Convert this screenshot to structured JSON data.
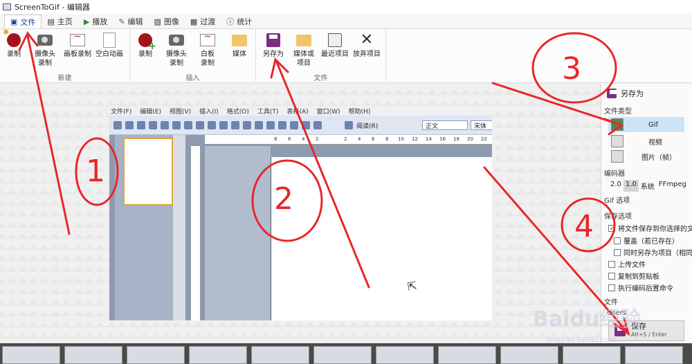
{
  "window": {
    "title": "ScreenToGif - 编辑器"
  },
  "tabs": [
    {
      "label": "文件",
      "icon": "save-icon",
      "active": true
    },
    {
      "label": "主页",
      "icon": "home-icon"
    },
    {
      "label": "播放",
      "icon": "play-icon"
    },
    {
      "label": "编辑",
      "icon": "pencil-icon"
    },
    {
      "label": "图像",
      "icon": "image-icon"
    },
    {
      "label": "过渡",
      "icon": "transition-icon"
    },
    {
      "label": "统计",
      "icon": "info-icon"
    }
  ],
  "ribbon": {
    "groups": [
      {
        "name": "新建",
        "items": [
          "录制",
          "摄像头\n录制",
          "画板录制",
          "空白动画"
        ]
      },
      {
        "name": "插入",
        "items": [
          "录制",
          "摄像头\n录制",
          "白板\n录制",
          "媒体"
        ]
      },
      {
        "name": "文件",
        "items": [
          "另存为",
          "媒体或\n项目",
          "最近项目",
          "放弃项目"
        ]
      }
    ]
  },
  "embedded_word": {
    "menu": [
      "文件(F)",
      "编辑(E)",
      "视图(V)",
      "插入(I)",
      "格式(O)",
      "工具(T)",
      "表格(A)",
      "窗口(W)",
      "帮助(H)"
    ],
    "read_button": "阅读(R)",
    "style_combo": "正文",
    "font_combo": "宋体",
    "ruler_numbers": [
      "8",
      "6",
      "4",
      "2",
      "2",
      "4",
      "6",
      "8",
      "10",
      "12",
      "14",
      "16",
      "18",
      "20",
      "22"
    ]
  },
  "save_panel": {
    "title": "另存为",
    "file_type_label": "文件类型",
    "types": [
      "Gif",
      "视频",
      "图片（帧）"
    ],
    "selected_type": "Gif",
    "encoder_label": "编码器",
    "encoders": [
      "2.0",
      "1.0",
      "系统",
      "FFmpeg"
    ],
    "selected_encoder": "1.0",
    "gif_options_label": "Gif 选项",
    "save_options_label": "保存选项",
    "options": [
      {
        "label": "将文件保存到你选择的文",
        "checked": true
      },
      {
        "label": "覆盖（若已存在）",
        "checked": false
      },
      {
        "label": "同时另存为项目（相同",
        "checked": false
      },
      {
        "label": "上传文件",
        "checked": false
      },
      {
        "label": "复制到剪贴板",
        "checked": false
      },
      {
        "label": "执行编码后置命令",
        "checked": false
      }
    ],
    "file_label": "文件",
    "path_placeholder": "Users",
    "save_button": "保存",
    "save_shortcut": "Alt+S / Enter"
  },
  "annotations": [
    "1",
    "2",
    "3",
    "4"
  ],
  "watermark": {
    "logo": "Baidu经验",
    "url": "jingyan.baidu.com"
  },
  "colors": {
    "accent_red": "#e8262a",
    "selection_blue": "#cde4f7",
    "record_red": "#a4131c",
    "save_purple": "#7b2f7c"
  }
}
